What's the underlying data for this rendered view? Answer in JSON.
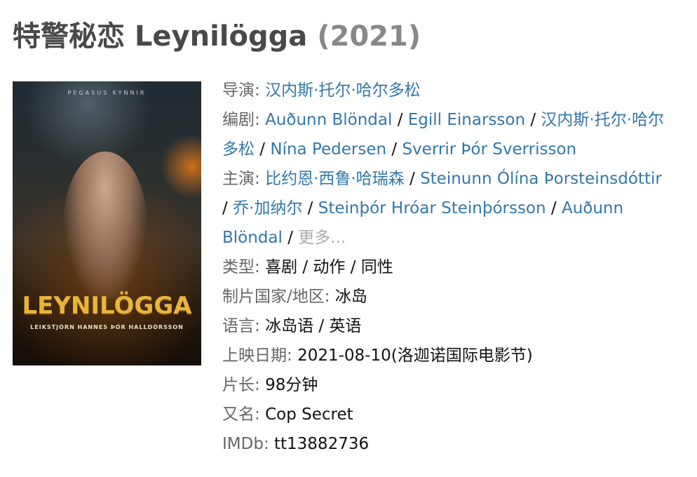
{
  "title": {
    "text": "特警秘恋 Leynilögga",
    "year": "(2021)"
  },
  "poster": {
    "top_text": "PEGASUS KYNNIR",
    "logo": "LEYNILÖGGA",
    "subtitle": "LEIKSTJÓRN HANNES ÞÓR HALLDÓRSSON"
  },
  "info": {
    "director": {
      "label": "导演",
      "names": [
        "汉内斯·托尔·哈尔多松"
      ]
    },
    "writers": {
      "label": "编剧",
      "names": [
        "Auðunn Blöndal",
        "Egill Einarsson",
        "汉内斯·托尔·哈尔多松",
        "Nína Pedersen",
        "Sverrir Þór Sverrisson"
      ],
      "line1": {
        "a": "Auðunn Blöndal",
        "b": "Egill Einarsson",
        "c": "汉内斯·托尔·哈尔"
      },
      "line2": {
        "c": "多松",
        "d": "Nína Pedersen",
        "e": "Sverrir Þór Sverrisson"
      }
    },
    "cast": {
      "label": "主演",
      "names": [
        "比约恩·西鲁·哈瑞森",
        "Steinunn Ólína Þorsteinsdóttir",
        "乔·加纳尔",
        "Steinþór Hróar Steinþórsson",
        "Auðunn Blöndal"
      ],
      "line1": {
        "a": "比约恩·西鲁·哈瑞森",
        "b": "Steinunn Ólína Þorsteinsdóttir"
      },
      "line2": {
        "c": "乔·加纳尔",
        "d": "Steinþór Hróar Steinþórsson",
        "e": "Auðunn"
      },
      "line3": {
        "e": "Blöndal"
      },
      "more": "更多..."
    },
    "genre": {
      "label": "类型",
      "value": "喜剧 / 动作 / 同性"
    },
    "country": {
      "label": "制片国家/地区",
      "value": "冰岛"
    },
    "language": {
      "label": "语言",
      "value": "冰岛语 / 英语"
    },
    "release_date": {
      "label": "上映日期",
      "value": "2021-08-10(洛迦诺国际电影节)"
    },
    "runtime": {
      "label": "片长",
      "value": "98分钟"
    },
    "aka": {
      "label": "又名",
      "value": "Cop Secret"
    },
    "imdb": {
      "label": "IMDb",
      "value": "tt13882736"
    }
  },
  "colors": {
    "link": "#3377aa",
    "label": "#666666",
    "title": "#494949",
    "year": "#888888",
    "more": "#aaaaaa"
  }
}
